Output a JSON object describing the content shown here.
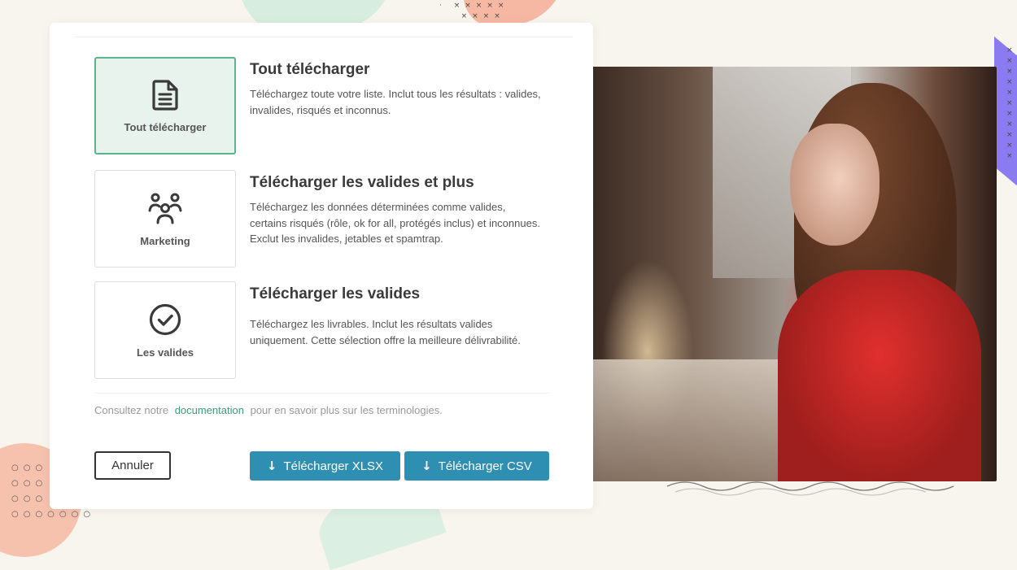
{
  "options": [
    {
      "label": "Tout télécharger",
      "icon": "document-icon",
      "title": "Tout télécharger",
      "description": "Téléchargez toute votre liste. Inclut tous les résultats : valides, invalides, risqués et inconnus.",
      "selected": true
    },
    {
      "label": "Marketing",
      "icon": "users-group-icon",
      "title": "Télécharger les valides et plus",
      "description": "Téléchargez les données déterminées comme valides, certains risqués (rôle, ok for all, protégés inclus) et inconnues. Exclut les invalides, jetables et spamtrap.",
      "selected": false
    },
    {
      "label": "Les valides",
      "icon": "check-circle-icon",
      "title": "Télécharger les valides",
      "description": "Téléchargez les livrables. Inclut les résultats valides uniquement. Cette sélection offre la meilleure délivrabilité.",
      "selected": false
    }
  ],
  "note": {
    "prefix": "Consultez notre",
    "link": "documentation",
    "suffix": "pour en savoir plus sur les terminologies."
  },
  "buttons": {
    "cancel": "Annuler",
    "xlsx": "Télécharger XLSX",
    "csv": "Télécharger CSV",
    "download_icon": "download-arrow-icon"
  },
  "colors": {
    "accent_green": "#5ab58d",
    "selected_bg": "#e8f3ee",
    "link_green": "#3d9b77",
    "primary_button": "#2f8fb2"
  }
}
